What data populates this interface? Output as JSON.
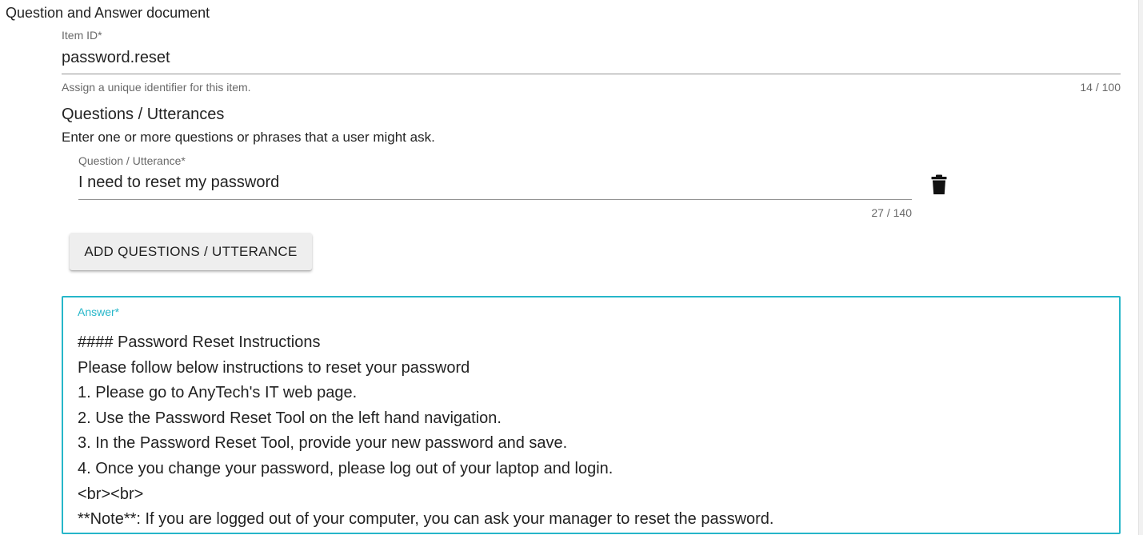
{
  "document": {
    "title": "Question and Answer document"
  },
  "item_id": {
    "label": "Item ID*",
    "value": "password.reset",
    "helper": "Assign a unique identifier for this item.",
    "counter": "14 / 100"
  },
  "questions": {
    "heading": "Questions / Utterances",
    "description": "Enter one or more questions or phrases that a user might ask.",
    "items": [
      {
        "label": "Question / Utterance*",
        "value": "I need to reset my password",
        "counter": "27 / 140",
        "delete_icon": "trash-icon"
      }
    ],
    "add_button_label": "ADD QUESTIONS / UTTERANCE"
  },
  "answer": {
    "label": "Answer*",
    "lines": [
      "#### Password Reset Instructions",
      "Please follow below instructions to reset your password",
      "1. Please go to AnyTech's IT web page.",
      "2. Use the Password Reset Tool on the left hand navigation.",
      "3. In the Password Reset Tool, provide your new password and save.",
      "4. Once you change your password, please log out of your laptop and login.",
      "<br><br>",
      "**Note**: If you are logged out of your computer, you can ask your manager to reset the password."
    ]
  },
  "colors": {
    "focus_accent": "#26b6c9",
    "button_bg": "#eeeeee"
  }
}
